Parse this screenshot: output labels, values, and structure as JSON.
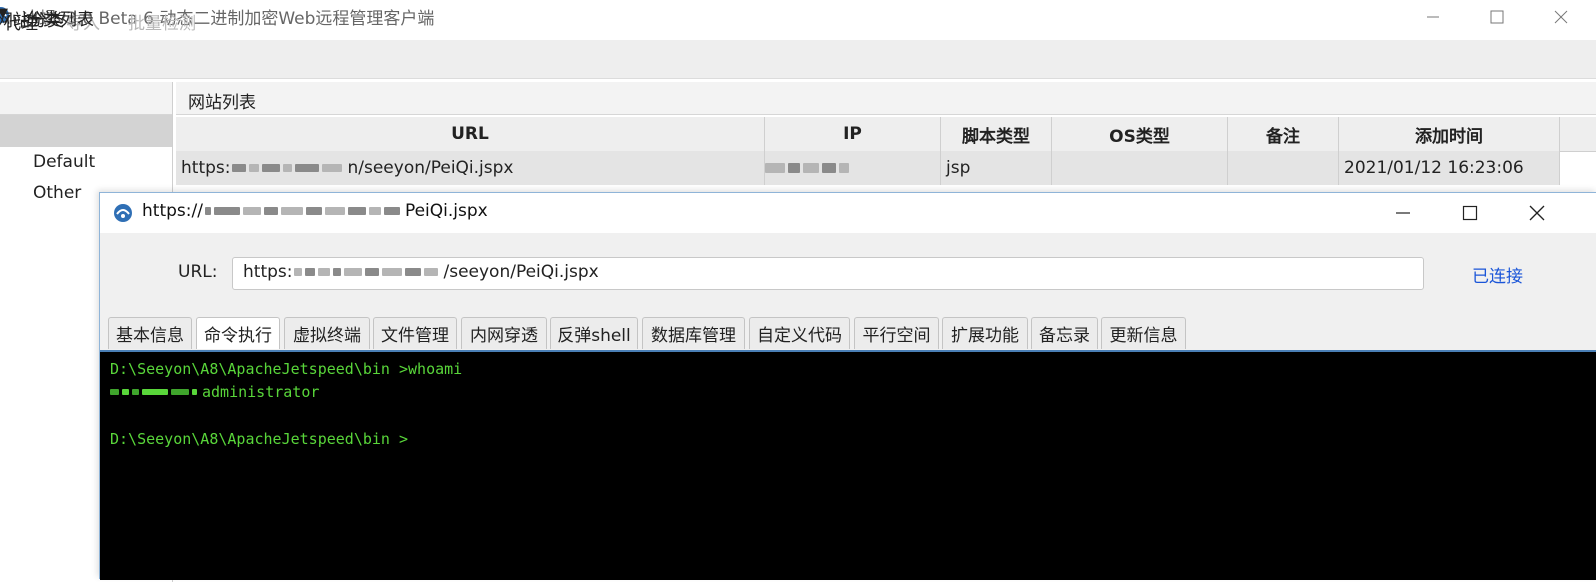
{
  "app": {
    "title": "冰蝎v3.0 Beta 6 动态二进制加密Web远程管理客户端",
    "icon": "scorpion-logo-icon"
  },
  "menubar": {
    "items": [
      {
        "label": "代理",
        "enabled": true
      },
      {
        "label": "导入",
        "enabled": false
      },
      {
        "label": "批量检测",
        "enabled": false
      }
    ]
  },
  "left_panel": {
    "header": "网站分类",
    "tree_root": "分类列表",
    "children": [
      "Default",
      "Other"
    ]
  },
  "site_list": {
    "header": "网站列表",
    "columns": [
      "URL",
      "IP",
      "脚本类型",
      "OS类型",
      "备注",
      "添加时间"
    ],
    "rows": [
      {
        "url_suffix": "n/seeyon/PeiQi.jspx",
        "script": "jsp",
        "os": "",
        "note": "",
        "added": "2021/01/12 16:23:06"
      }
    ]
  },
  "dialog": {
    "title_prefix": "https://",
    "title_suffix": "PeiQi.jspx",
    "url_label": "URL:",
    "url_prefix": "https:",
    "url_suffix": "/seeyon/PeiQi.jspx",
    "status": "已连接",
    "status_color": "#1a55d8",
    "tabs": [
      "基本信息",
      "命令执行",
      "虚拟终端",
      "文件管理",
      "内网穿透",
      "反弹shell",
      "数据库管理",
      "自定义代码",
      "平行空间",
      "扩展功能",
      "备忘录",
      "更新信息"
    ],
    "active_tab": "命令执行"
  },
  "terminal": {
    "line1": "D:\\Seeyon\\A8\\ApacheJetspeed\\bin >whoami",
    "line2_suffix": "administrator",
    "line3": "D:\\Seeyon\\A8\\ApacheJetspeed\\bin >",
    "text_color": "#59d63a"
  }
}
